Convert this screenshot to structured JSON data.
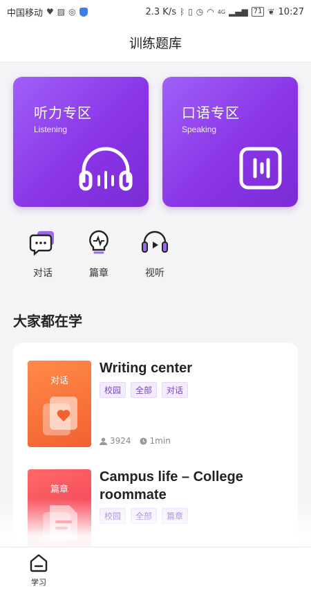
{
  "status_bar": {
    "carrier": "中国移动",
    "speed": "2.3 K/s",
    "network": "4G",
    "battery": "71",
    "time": "10:27"
  },
  "header": {
    "title": "训练题库"
  },
  "feature_cards": [
    {
      "title": "听力专区",
      "subtitle": "Listening",
      "icon": "headphones-icon"
    },
    {
      "title": "口语专区",
      "subtitle": "Speaking",
      "icon": "voice-icon"
    }
  ],
  "shortcuts": [
    {
      "label": "对话",
      "icon": "chat-bubble-icon"
    },
    {
      "label": "篇章",
      "icon": "lightbulb-icon"
    },
    {
      "label": "视听",
      "icon": "video-headphones-icon"
    }
  ],
  "section": {
    "title": "大家都在学"
  },
  "courses": [
    {
      "thumb_label": "对话",
      "title": "Writing center",
      "tags": [
        "校园",
        "全部",
        "对话"
      ],
      "learners": "3924",
      "duration": "1min"
    },
    {
      "thumb_label": "篇章",
      "title": "Campus life – College roommate",
      "tags": [
        "校园",
        "全部",
        "篇章"
      ]
    }
  ],
  "bottom_nav": {
    "items": [
      {
        "label": "学习",
        "icon": "home-icon"
      }
    ]
  },
  "colors": {
    "accent": "#8a35e6",
    "orange": "#f3612e",
    "red": "#ec2f4b"
  }
}
